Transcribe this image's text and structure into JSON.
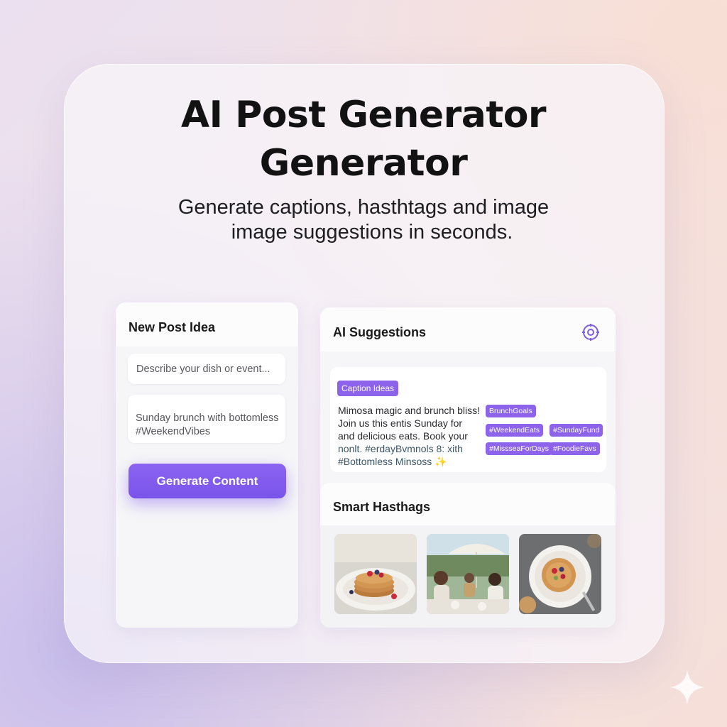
{
  "hero": {
    "title_line1": "AI Post Generator",
    "title_line2": "Generator",
    "subtitle_line1": "Generate captions, hasthtags and image",
    "subtitle_line2": "image suggestions in seconds."
  },
  "new_post": {
    "heading": "New Post Idea",
    "description_placeholder": "Describe your dish or event...",
    "example_value": "Sunday brunch with bottomless #WeekendVibes",
    "generate_label": "Generate Content"
  },
  "suggestions": {
    "heading": "AI Suggestions",
    "caption_badge": "Caption Ideas",
    "caption_lines": [
      "Mimosa magic and brunch bliss!",
      "Join us this entis Sunday for",
      "and delicious eats. Book your",
      "nonlt. #erdayBvmnols 8: xith",
      "#Bottomless Minsoss ✨"
    ],
    "hashtag_chips": [
      "BrunchGoals",
      "#WeekendEats",
      "#SundayFund",
      "#MissseaForDays",
      "#FoodieFavs"
    ],
    "smart_hashtags_heading": "Smart Hasthags",
    "images": [
      "pancakes-plate",
      "outdoor-brunch-friends",
      "pancakes-topdown"
    ]
  },
  "colors": {
    "accent": "#7c56ec",
    "badge": "#8c63ea",
    "text_dark": "#121212"
  }
}
